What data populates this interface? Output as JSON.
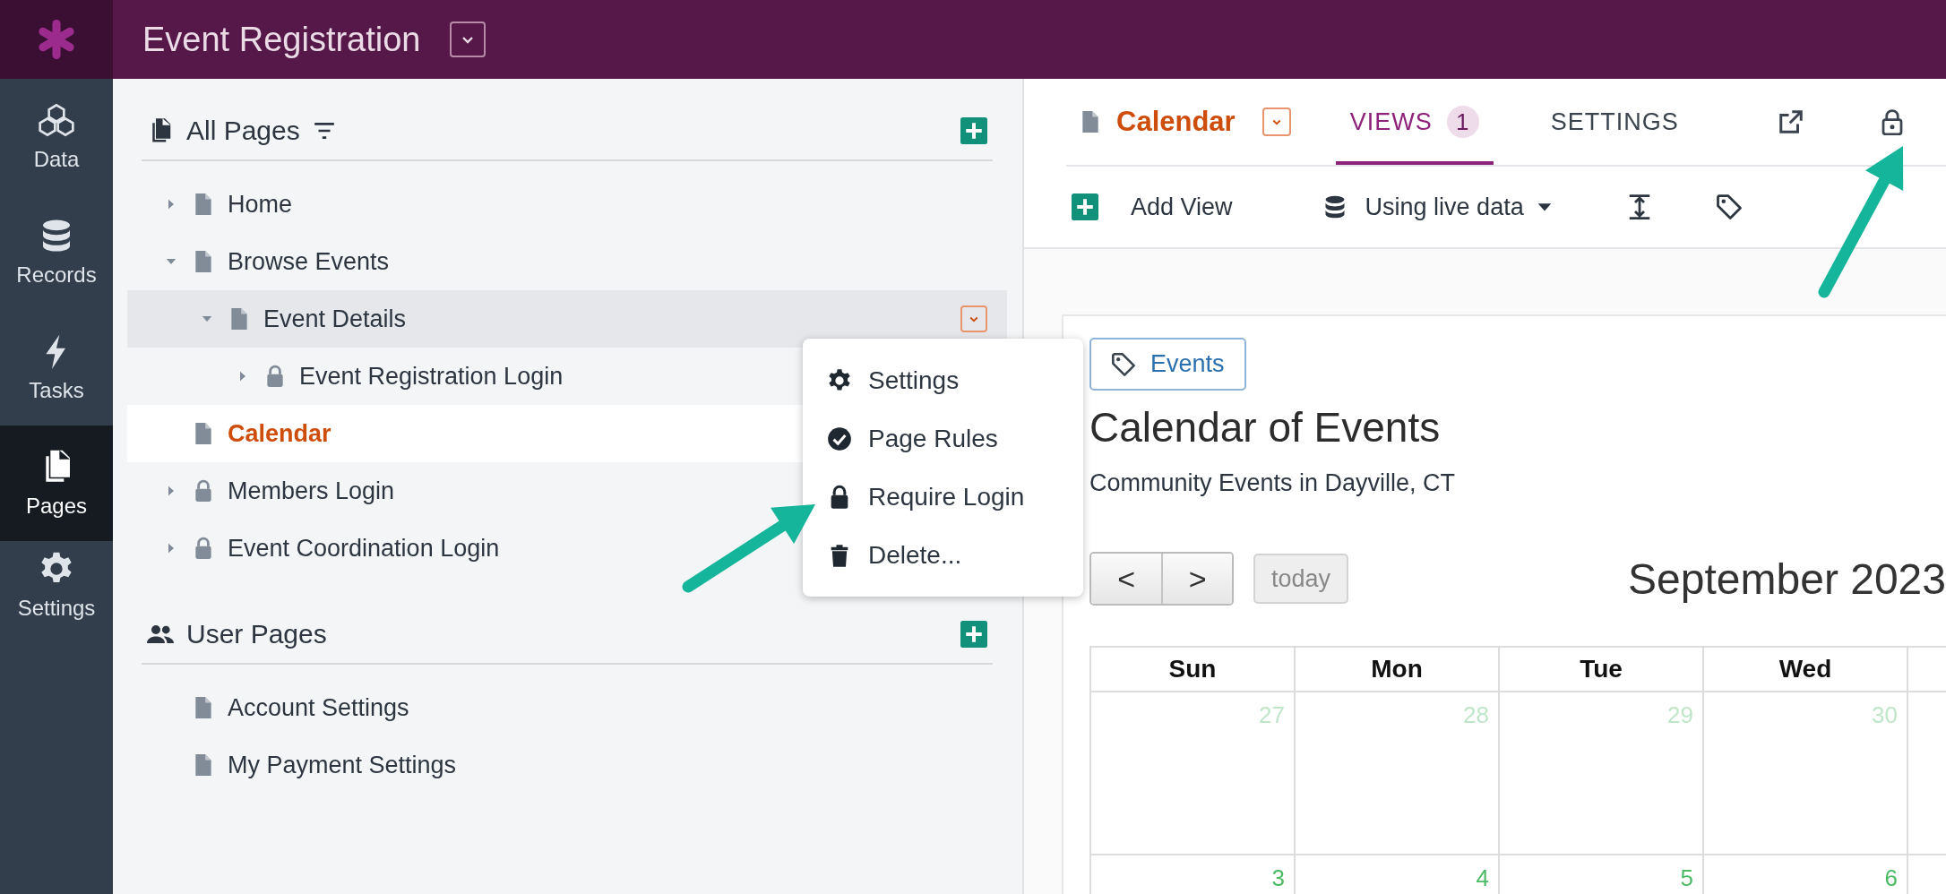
{
  "app": {
    "title": "Event Registration"
  },
  "nav": [
    {
      "label": "Data",
      "selected": false
    },
    {
      "label": "Records",
      "selected": false
    },
    {
      "label": "Tasks",
      "selected": false
    },
    {
      "label": "Pages",
      "selected": true
    },
    {
      "label": "Settings",
      "selected": false
    }
  ],
  "sidebar": {
    "sections": [
      {
        "title": "All Pages",
        "filter": true,
        "items": [
          {
            "label": "Home",
            "kind": "page",
            "expanded": false,
            "selected": false
          },
          {
            "label": "Browse Events",
            "kind": "page",
            "expanded": true,
            "selected": false,
            "children": [
              {
                "label": "Event Details",
                "kind": "page",
                "expanded": true,
                "selected": false,
                "hovered": true,
                "children": [
                  {
                    "label": "Event Registration Login",
                    "kind": "login",
                    "expanded": false,
                    "selected": false
                  }
                ]
              }
            ]
          },
          {
            "label": "Calendar",
            "kind": "page",
            "selected": true
          },
          {
            "label": "Members Login",
            "kind": "login",
            "expanded": false,
            "selected": false
          },
          {
            "label": "Event Coordination Login",
            "kind": "login",
            "expanded": false,
            "selected": false
          }
        ]
      },
      {
        "title": "User Pages",
        "items": [
          {
            "label": "Account Settings",
            "kind": "page",
            "selected": false
          },
          {
            "label": "My Payment Settings",
            "kind": "page",
            "selected": false
          }
        ]
      }
    ]
  },
  "context_menu": {
    "items": [
      {
        "label": "Settings"
      },
      {
        "label": "Page Rules"
      },
      {
        "label": "Require Login"
      },
      {
        "label": "Delete..."
      }
    ]
  },
  "page": {
    "title": "Calendar",
    "tabs": [
      {
        "label": "VIEWS",
        "badge": "1",
        "selected": true
      },
      {
        "label": "SETTINGS",
        "selected": false
      }
    ],
    "toolbar": {
      "add_label": "Add View",
      "data_source": "Using live data"
    },
    "content": {
      "tag": "Events",
      "title": "Calendar of Events",
      "subtitle": "Community Events in Dayville, CT",
      "prev": "<",
      "next": ">",
      "today": "today",
      "month": "September 2023",
      "days": [
        "Sun",
        "Mon",
        "Tue",
        "Wed"
      ],
      "weeks": [
        [
          {
            "date": "27",
            "other_month": true
          },
          {
            "date": "28",
            "other_month": true
          },
          {
            "date": "29",
            "other_month": true
          },
          {
            "date": "30",
            "other_month": true
          }
        ],
        [
          {
            "date": "3",
            "other_month": false
          },
          {
            "date": "4",
            "other_month": false
          },
          {
            "date": "5",
            "other_month": false
          },
          {
            "date": "6",
            "other_month": false
          }
        ]
      ]
    }
  }
}
